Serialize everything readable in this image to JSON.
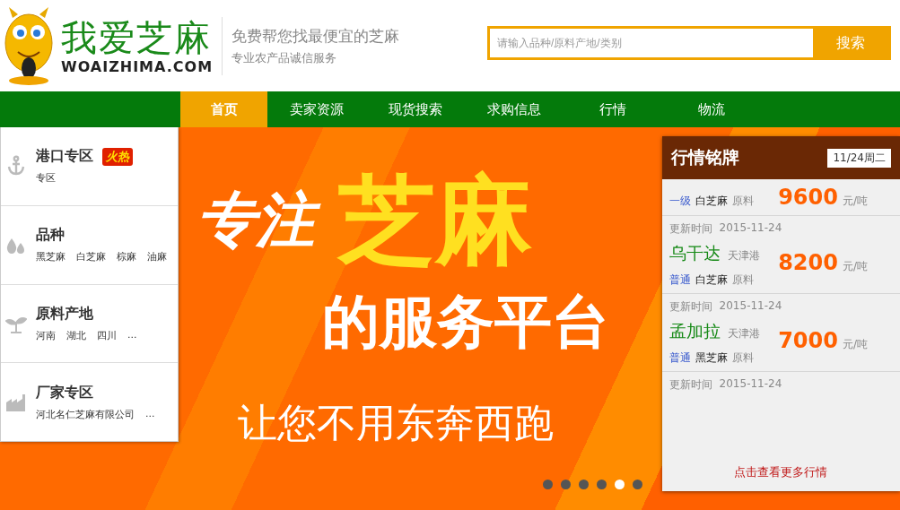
{
  "header": {
    "logo_title": "我爱芝麻",
    "logo_domain": "WOAIZHIMA.COM",
    "slogan": "免费帮您找最便宜的芝麻",
    "subslogan": "专业农产品诚信服务"
  },
  "search": {
    "placeholder": "请输入品种/原料产地/类别",
    "button": "搜索"
  },
  "nav": [
    {
      "label": "首页",
      "selected": true
    },
    {
      "label": "卖家资源",
      "selected": false
    },
    {
      "label": "现货搜索",
      "selected": false
    },
    {
      "label": "求购信息",
      "selected": false
    },
    {
      "label": "行情",
      "selected": false
    },
    {
      "label": "物流",
      "selected": false
    }
  ],
  "sidebar": [
    {
      "kind": "anchor",
      "title": "港口专区",
      "badge": "火热",
      "links": [
        "专区"
      ]
    },
    {
      "kind": "drops",
      "title": "品种",
      "links": [
        "黑芝麻",
        "白芝麻",
        "棕麻",
        "油麻"
      ]
    },
    {
      "kind": "sprout",
      "title": "原料产地",
      "links": [
        "河南",
        "湖北",
        "四川",
        "..."
      ]
    },
    {
      "kind": "factory",
      "title": "厂家专区",
      "links": [
        "河北名仁芝麻有限公司",
        "..."
      ]
    }
  ],
  "banner": {
    "line1_prefix": "专注",
    "line1_highlight": "芝麻",
    "line2": "的服务平台",
    "line3": "让您不用东奔西跑",
    "dots": [
      {
        "selected": false
      },
      {
        "selected": false
      },
      {
        "selected": false
      },
      {
        "selected": false
      },
      {
        "selected": true
      },
      {
        "selected": false
      }
    ]
  },
  "market": {
    "title": "行情铭牌",
    "date": "11/24周二",
    "more": "点击查看更多行情",
    "cards": [
      {
        "grade": "一级",
        "variety": "白芝麻",
        "type": "原料",
        "price": "9600",
        "unit": "元/吨"
      },
      {
        "updated_label": "更新时间",
        "updated": "2015-11-24",
        "origin": "乌干达",
        "port": "天津港",
        "grade": "普通",
        "variety": "白芝麻",
        "type": "原料",
        "price": "8200",
        "unit": "元/吨"
      },
      {
        "updated_label": "更新时间",
        "updated": "2015-11-24",
        "origin": "孟加拉",
        "port": "天津港",
        "grade": "普通",
        "variety": "黑芝麻",
        "type": "原料",
        "price": "7000",
        "unit": "元/吨"
      },
      {
        "updated_label": "更新时间",
        "updated": "2015-11-24"
      }
    ]
  }
}
